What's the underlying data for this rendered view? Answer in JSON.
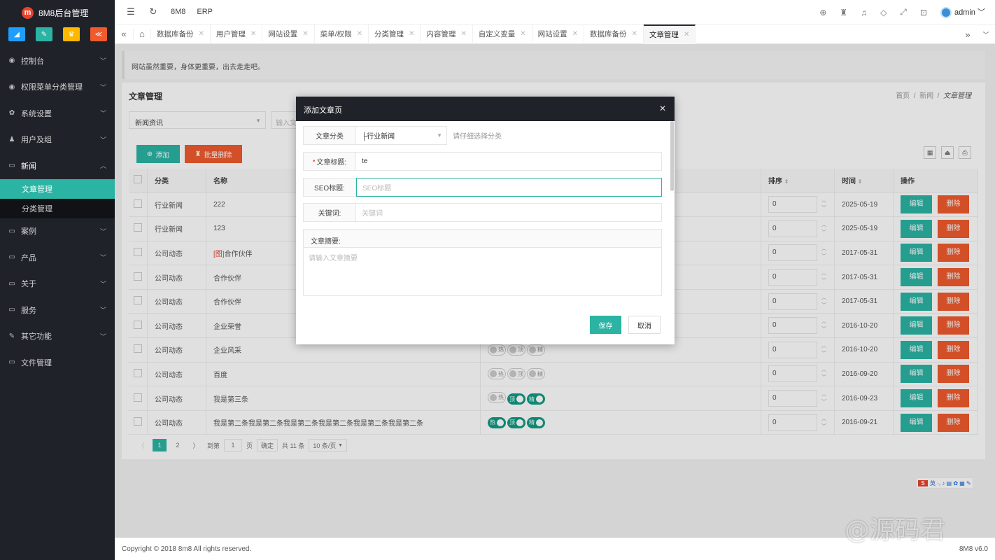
{
  "app": {
    "title": "8M8后台管理",
    "logo_letter": "m"
  },
  "quick_buttons": [
    {
      "icon": "chart-icon",
      "glyph": "◢",
      "color": "#1e9fff"
    },
    {
      "icon": "edit-icon",
      "glyph": "✎",
      "color": "#2bb3a3"
    },
    {
      "icon": "shop-icon",
      "glyph": "♛",
      "color": "#ffb800"
    },
    {
      "icon": "share-icon",
      "glyph": "≪",
      "color": "#ef5b2d"
    }
  ],
  "sidebar": {
    "items": [
      {
        "label": "控制台",
        "icon": "dashboard-icon",
        "glyph": "◉",
        "chevron": "﹀"
      },
      {
        "label": "权限菜单分类管理",
        "icon": "dashboard-icon",
        "glyph": "◉",
        "chevron": "﹀"
      },
      {
        "label": "系统设置",
        "icon": "gear-icon",
        "glyph": "✿",
        "chevron": "﹀"
      },
      {
        "label": "用户及组",
        "icon": "users-icon",
        "glyph": "♟",
        "chevron": "﹀"
      },
      {
        "label": "新闻",
        "icon": "monitor-icon",
        "glyph": "▭",
        "chevron": "︿"
      },
      {
        "label": "案例",
        "icon": "monitor-icon",
        "glyph": "▭",
        "chevron": "﹀"
      },
      {
        "label": "产品",
        "icon": "monitor-icon",
        "glyph": "▭",
        "chevron": "﹀"
      },
      {
        "label": "关于",
        "icon": "monitor-icon",
        "glyph": "▭",
        "chevron": "﹀"
      },
      {
        "label": "服务",
        "icon": "monitor-icon",
        "glyph": "▭",
        "chevron": "﹀"
      },
      {
        "label": "其它功能",
        "icon": "wrench-icon",
        "glyph": "✎",
        "chevron": "﹀"
      },
      {
        "label": "文件管理",
        "icon": "monitor-icon",
        "glyph": "▭",
        "chevron": ""
      }
    ],
    "sub_items": [
      {
        "label": "文章管理"
      },
      {
        "label": "分类管理"
      }
    ]
  },
  "topbar": {
    "links": [
      "8M8",
      "ERP"
    ],
    "user": "admin"
  },
  "tabs": [
    "数据库备份",
    "用户管理",
    "网站设置",
    "菜单/权限",
    "分类管理",
    "内容管理",
    "自定义变量",
    "网站设置",
    "数据库备份",
    "文章管理"
  ],
  "notice": "网站虽然重要，身体更重要，出去走走吧。",
  "page": {
    "title": "文章管理",
    "breadcrumb": [
      "首页",
      "新闻",
      "文章管理"
    ],
    "filter_select": "新闻资讯",
    "search_placeholder": "输入文章标题",
    "add_label": "添加",
    "batch_delete_label": "批量删除"
  },
  "table": {
    "headers": {
      "category": "分类",
      "name": "名称",
      "sort": "排序",
      "time": "时间",
      "action": "操作"
    },
    "edit_label": "编辑",
    "delete_label": "删除",
    "switch_labels": [
      "热",
      "顶",
      "精"
    ],
    "rows": [
      {
        "category": "行业新闻",
        "name": "222",
        "sort": "0",
        "time": "2025-05-19",
        "flags": null,
        "tag": ""
      },
      {
        "category": "行业新闻",
        "name": "123",
        "sort": "0",
        "time": "2025-05-19",
        "flags": null,
        "tag": ""
      },
      {
        "category": "公司动态",
        "name": "合作伙伴",
        "sort": "0",
        "time": "2017-05-31",
        "flags": null,
        "tag": "[图]"
      },
      {
        "category": "公司动态",
        "name": "合作伙伴",
        "sort": "0",
        "time": "2017-05-31",
        "flags": null,
        "tag": ""
      },
      {
        "category": "公司动态",
        "name": "合作伙伴",
        "sort": "0",
        "time": "2017-05-31",
        "flags": null,
        "tag": ""
      },
      {
        "category": "公司动态",
        "name": "企业荣誉",
        "sort": "0",
        "time": "2016-10-20",
        "flags": null,
        "tag": ""
      },
      {
        "category": "公司动态",
        "name": "企业风采",
        "sort": "0",
        "time": "2016-10-20",
        "flags": [
          false,
          false,
          false
        ],
        "tag": ""
      },
      {
        "category": "公司动态",
        "name": "百度",
        "sort": "0",
        "time": "2016-09-20",
        "flags": [
          false,
          false,
          false
        ],
        "tag": ""
      },
      {
        "category": "公司动态",
        "name": "我是第三条",
        "sort": "0",
        "time": "2016-09-23",
        "flags": [
          false,
          true,
          true
        ],
        "tag": ""
      },
      {
        "category": "公司动态",
        "name": "我是第二条我是第二条我是第二条我是第二条我是第二条我是第二条",
        "sort": "0",
        "time": "2016-09-21",
        "flags": [
          true,
          true,
          true
        ],
        "tag": ""
      }
    ]
  },
  "pager": {
    "prev": "〈",
    "pages": [
      "1",
      "2"
    ],
    "next": "〉",
    "goto": "到第",
    "page_value": "1",
    "page_unit": "页",
    "confirm": "确定",
    "total": "共 11 条",
    "per_page": "10 条/页"
  },
  "modal": {
    "title": "添加文章页",
    "fields": {
      "category_label": "文章分类",
      "category_value": "├行业新闻",
      "category_hint": "请仔细选择分类",
      "title_label": "文章标题:",
      "title_value": "te",
      "seo_label": "SEO标题:",
      "seo_placeholder": "SEO标题",
      "keywords_label": "关键词:",
      "keywords_placeholder": "关键词",
      "abstract_label": "文章摘要:",
      "abstract_placeholder": "请输入文章摘要"
    },
    "save_label": "保存",
    "cancel_label": "取消"
  },
  "footer": {
    "copyright": "Copyright © 2018 8m8 All rights reserved.",
    "version": "8M8 v6.0"
  },
  "ime": {
    "logo": "S",
    "text": "英 ·, ♪ ▤ ✿ ▦ ✎"
  },
  "watermark": "@源码君"
}
